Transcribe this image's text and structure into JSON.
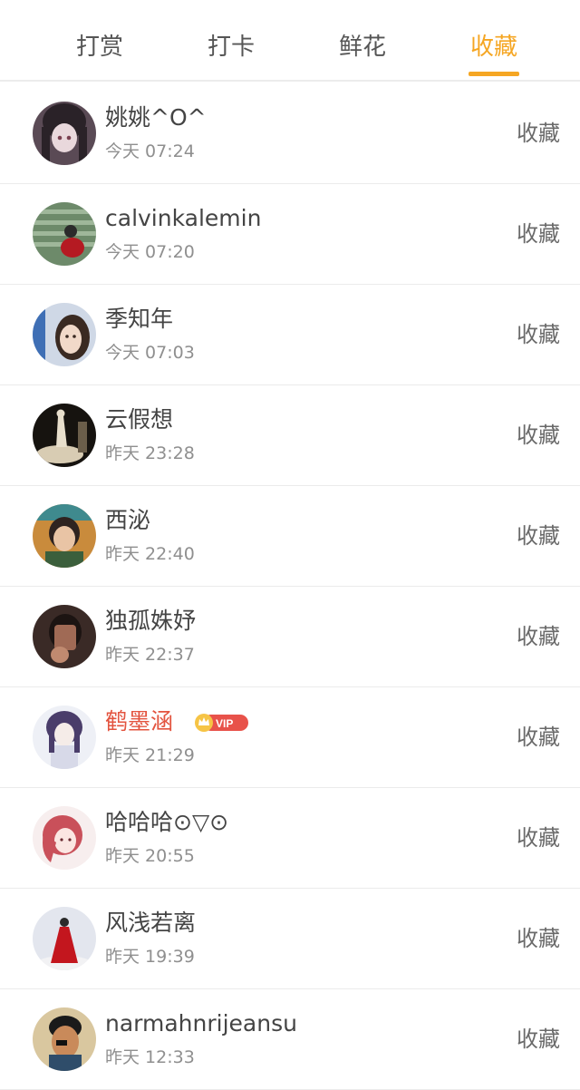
{
  "tabs": [
    {
      "label": "打赏"
    },
    {
      "label": "打卡"
    },
    {
      "label": "鲜花"
    },
    {
      "label": "收藏"
    }
  ],
  "active_tab": "收藏",
  "accent_color": "#f5a623",
  "vip_name_color": "#e3543f",
  "items": [
    {
      "name": "姚姚^O^",
      "time": "今天 07:24",
      "action": "收藏"
    },
    {
      "name": "calvinkalemin",
      "time": "今天 07:20",
      "action": "收藏"
    },
    {
      "name": "季知年",
      "time": "今天 07:03",
      "action": "收藏"
    },
    {
      "name": "云假想",
      "time": "昨天 23:28",
      "action": "收藏"
    },
    {
      "name": "西泌",
      "time": "昨天 22:40",
      "action": "收藏"
    },
    {
      "name": "独孤姝妤",
      "time": "昨天 22:37",
      "action": "收藏"
    },
    {
      "name": "鹤墨涵",
      "time": "昨天 21:29",
      "action": "收藏",
      "vip_label": "VIP"
    },
    {
      "name": "哈哈哈⊙▽⊙",
      "time": "昨天 20:55",
      "action": "收藏"
    },
    {
      "name": "风浅若离",
      "time": "昨天 19:39",
      "action": "收藏"
    },
    {
      "name": "narmahnrijeansu",
      "time": "昨天 12:33",
      "action": "收藏"
    }
  ]
}
